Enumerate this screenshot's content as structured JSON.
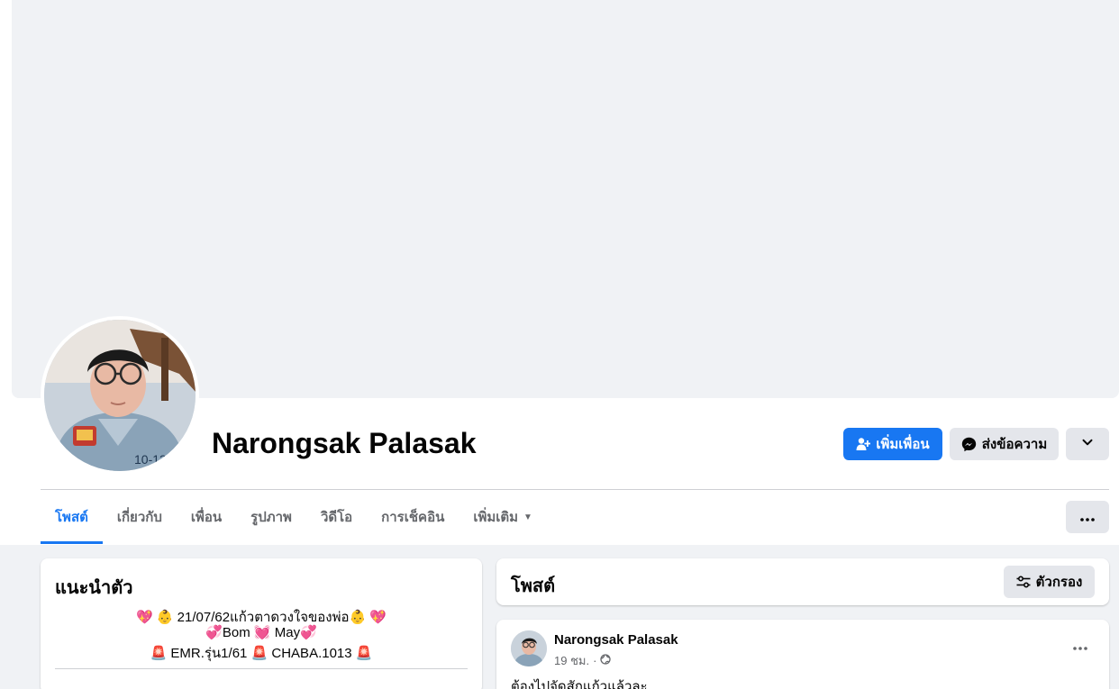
{
  "profile": {
    "name": "Narongsak Palasak"
  },
  "actions": {
    "add_friend": "เพิ่มเพื่อน",
    "message": "ส่งข้อความ"
  },
  "tabs": [
    {
      "label": "โพสต์",
      "active": true
    },
    {
      "label": "เกี่ยวกับ"
    },
    {
      "label": "เพื่อน"
    },
    {
      "label": "รูปภาพ"
    },
    {
      "label": "วิดีโอ"
    },
    {
      "label": "การเช็คอิน"
    },
    {
      "label": "เพิ่มเติม"
    }
  ],
  "intro": {
    "title": "แนะนำตัว",
    "bio_lines": [
      "💖 👶 21/07/62แก้วตาดวงใจของพ่อ👶 💖",
      "💞Bom 💓 May💞",
      "🚨 EMR.รุ่น1/61 🚨 CHABA.1013 🚨"
    ]
  },
  "posts_header": {
    "title": "โพสต์",
    "filter_label": "ตัวกรอง"
  },
  "post": {
    "author": "Narongsak Palasak",
    "time": "19 ชม.",
    "separator": "·",
    "text": "ต้องไปจัดสักแก้วแล้วละ"
  },
  "colors": {
    "accent": "#1877f2",
    "secondary_button": "#e4e6eb",
    "page_bg": "#f0f2f5"
  },
  "icons": {
    "add_friend": "person-plus-icon",
    "message": "messenger-icon",
    "dropdown": "chevron-down-icon",
    "more": "ellipsis-icon",
    "filter": "filter-sliders-icon",
    "privacy": "globe-icon"
  }
}
